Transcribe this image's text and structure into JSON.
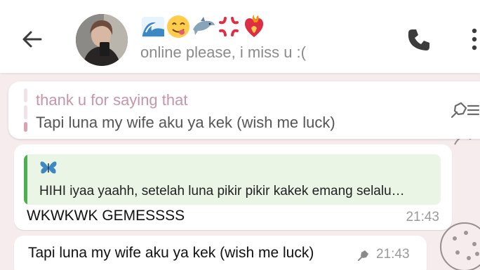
{
  "header": {
    "contact_emojis": [
      "wave-emoji",
      "yum-face-emoji",
      "dolphin-emoji",
      "anger-symbol-emoji",
      "heart-on-fire-emoji"
    ],
    "status": "online please, i miss u :("
  },
  "pinned": {
    "title": "thank u for saying that",
    "message": "Tapi luna my wife aku ya kek (wish me luck)"
  },
  "messages": [
    {
      "quote_author_icon": "butterfly-emoji",
      "quote_text": "HIHI iyaa yaahh, setelah luna pikir pikir kakek emang selalu…",
      "text": "WKWKWK GEMESSSS",
      "time": "21:43"
    },
    {
      "text": "Tapi luna my wife aku ya kek (wish me luck)",
      "pinned": true,
      "time": "21:43"
    }
  ],
  "colors": {
    "wallpaper": "#f6ecee",
    "pinned_title": "#c497a3",
    "quote_background": "#eaf5e6",
    "quote_stripe": "#4caf50"
  }
}
